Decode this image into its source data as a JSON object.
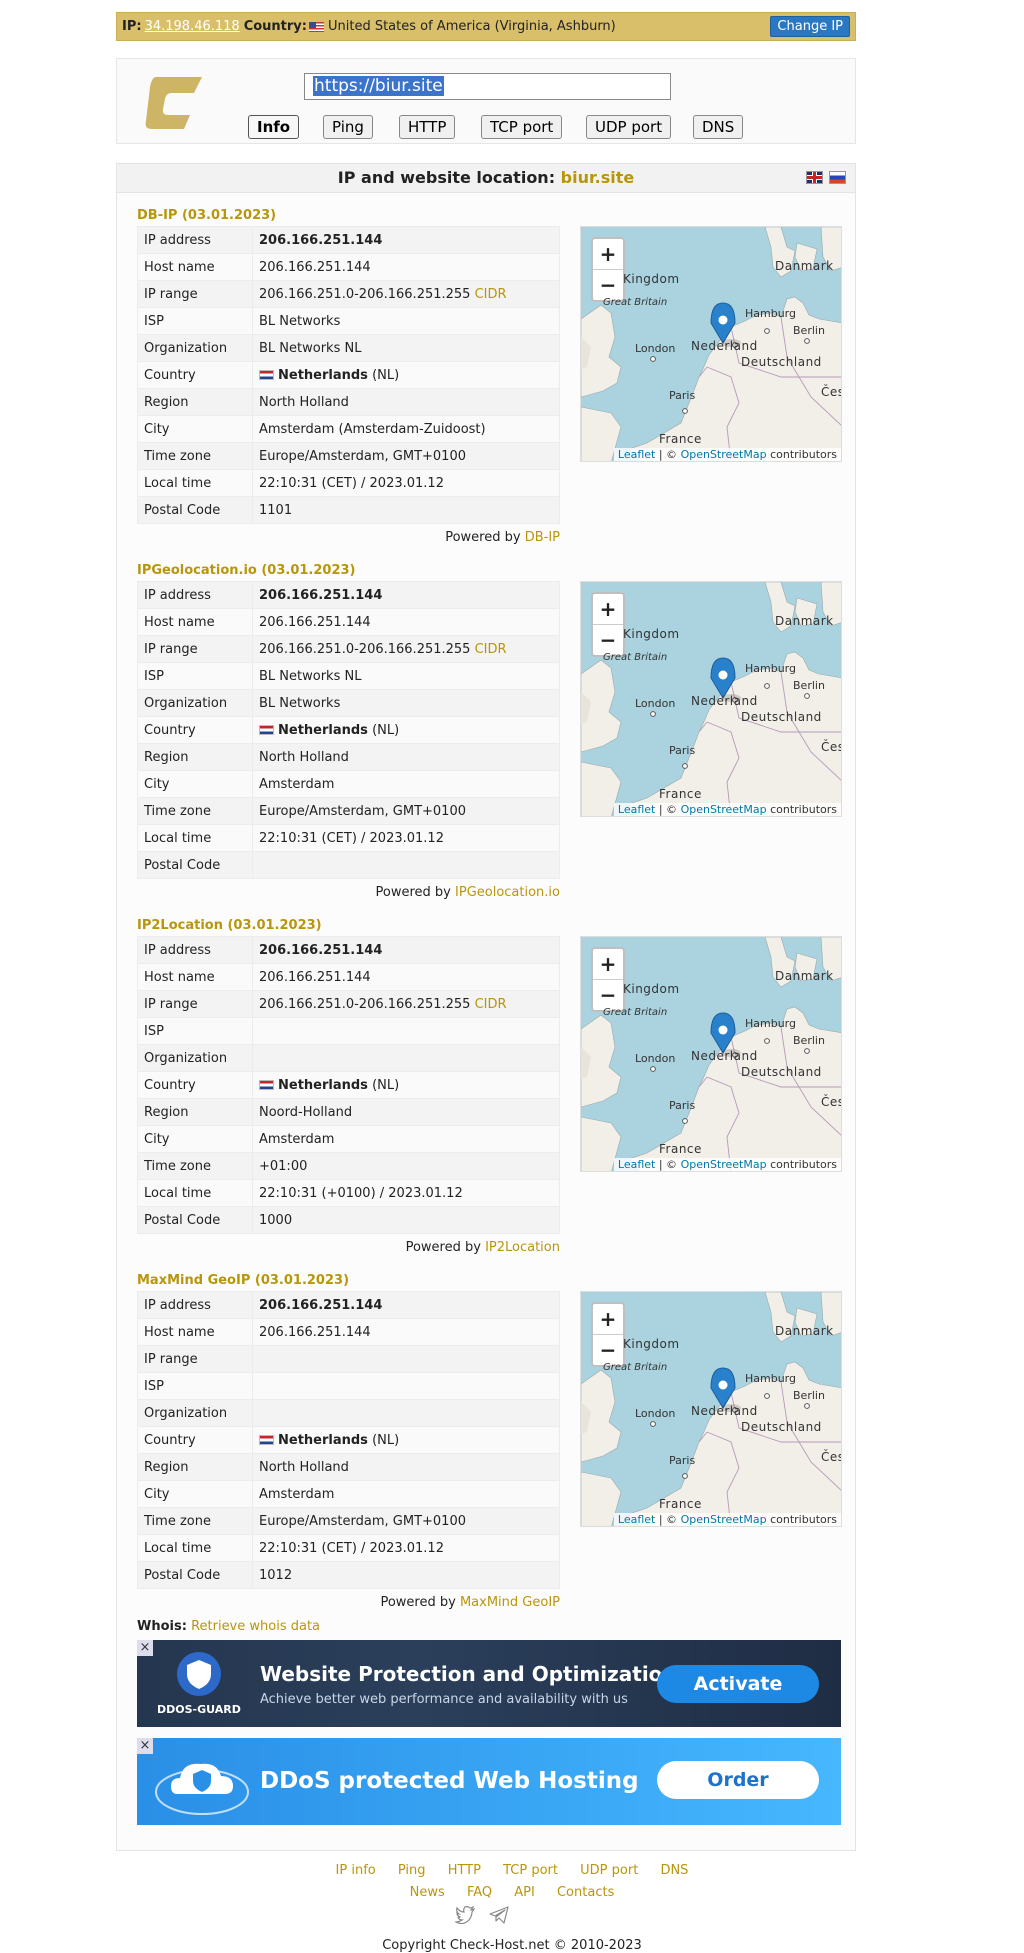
{
  "ipbar": {
    "ip_label": "IP",
    "ip_value": "34.198.46.118",
    "country_label": "Country",
    "country_value": "United States of America (Virginia, Ashburn)",
    "change_ip": "Change IP"
  },
  "header": {
    "url_value": "https://biur.site",
    "tabs": [
      "Info",
      "Ping",
      "HTTP",
      "TCP port",
      "UDP port",
      "DNS"
    ],
    "active_tab": "Info"
  },
  "main": {
    "title_prefix": "IP and website location:",
    "title_host": "biur.site"
  },
  "labels": {
    "ip_address": "IP address",
    "host_name": "Host name",
    "ip_range": "IP range",
    "isp": "ISP",
    "organization": "Organization",
    "country": "Country",
    "region": "Region",
    "city": "City",
    "time_zone": "Time zone",
    "local_time": "Local time",
    "postal_code": "Postal Code",
    "cidr": "CIDR",
    "powered_by": "Powered by"
  },
  "map": {
    "labels": [
      "Kingdom",
      "Great Britain",
      "Danmark",
      "Hamburg",
      "Berlin",
      "London",
      "Nederland",
      "Deutschland",
      "Paris",
      "Česk",
      "France"
    ],
    "zoom_in": "+",
    "zoom_out": "−",
    "attr_leaflet": "Leaflet",
    "attr_sep": "| ©",
    "attr_osm": "OpenStreetMap",
    "attr_tail": "contributors"
  },
  "sections": [
    {
      "title": "DB-IP (03.01.2023)",
      "ip_address": "206.166.251.144",
      "host_name": "206.166.251.144",
      "ip_range": "206.166.251.0-206.166.251.255",
      "isp": "BL Networks",
      "organization": "BL Networks NL",
      "country_name": "Netherlands",
      "country_code": "(NL)",
      "region": "North Holland",
      "city": "Amsterdam (Amsterdam-Zuidoost)",
      "time_zone": "Europe/Amsterdam, GMT+0100",
      "local_time": "22:10:31 (CET) / 2023.01.12",
      "postal_code": "1101",
      "provider": "DB-IP"
    },
    {
      "title": "IPGeolocation.io (03.01.2023)",
      "ip_address": "206.166.251.144",
      "host_name": "206.166.251.144",
      "ip_range": "206.166.251.0-206.166.251.255",
      "isp": "BL Networks NL",
      "organization": "BL Networks",
      "country_name": "Netherlands",
      "country_code": "(NL)",
      "region": "North Holland",
      "city": "Amsterdam",
      "time_zone": "Europe/Amsterdam, GMT+0100",
      "local_time": "22:10:31 (CET) / 2023.01.12",
      "postal_code": "",
      "provider": "IPGeolocation.io"
    },
    {
      "title": "IP2Location (03.01.2023)",
      "ip_address": "206.166.251.144",
      "host_name": "206.166.251.144",
      "ip_range": "206.166.251.0-206.166.251.255",
      "isp": "",
      "organization": "",
      "country_name": "Netherlands",
      "country_code": "(NL)",
      "region": "Noord-Holland",
      "city": "Amsterdam",
      "time_zone": "+01:00",
      "local_time": "22:10:31 (+0100) / 2023.01.12",
      "postal_code": "1000",
      "provider": "IP2Location"
    },
    {
      "title": "MaxMind GeoIP (03.01.2023)",
      "ip_address": "206.166.251.144",
      "host_name": "206.166.251.144",
      "ip_range": "",
      "isp": "",
      "organization": "",
      "country_name": "Netherlands",
      "country_code": "(NL)",
      "region": "North Holland",
      "city": "Amsterdam",
      "time_zone": "Europe/Amsterdam, GMT+0100",
      "local_time": "22:10:31 (CET) / 2023.01.12",
      "postal_code": "1012",
      "provider": "MaxMind GeoIP"
    }
  ],
  "whois": {
    "label": "Whois:",
    "link": "Retrieve whois data"
  },
  "ads": [
    {
      "brand": "DDOS-GUARD",
      "title": "Website Protection and Optimization",
      "subtitle": "Achieve better web performance and availability with us",
      "button": "Activate",
      "close": "×"
    },
    {
      "title": "DDoS protected Web Hosting",
      "button": "Order",
      "close": "×"
    }
  ],
  "footer": {
    "row1": [
      "IP info",
      "Ping",
      "HTTP",
      "TCP port",
      "UDP port",
      "DNS"
    ],
    "row2": [
      "News",
      "FAQ",
      "API",
      "Contacts"
    ],
    "copyright": "Copyright Check-Host.net © 2010-2023"
  },
  "colors": {
    "accent": "#b8960c",
    "ipbar": "#d9bf6a",
    "button_blue": "#2b78c2"
  }
}
